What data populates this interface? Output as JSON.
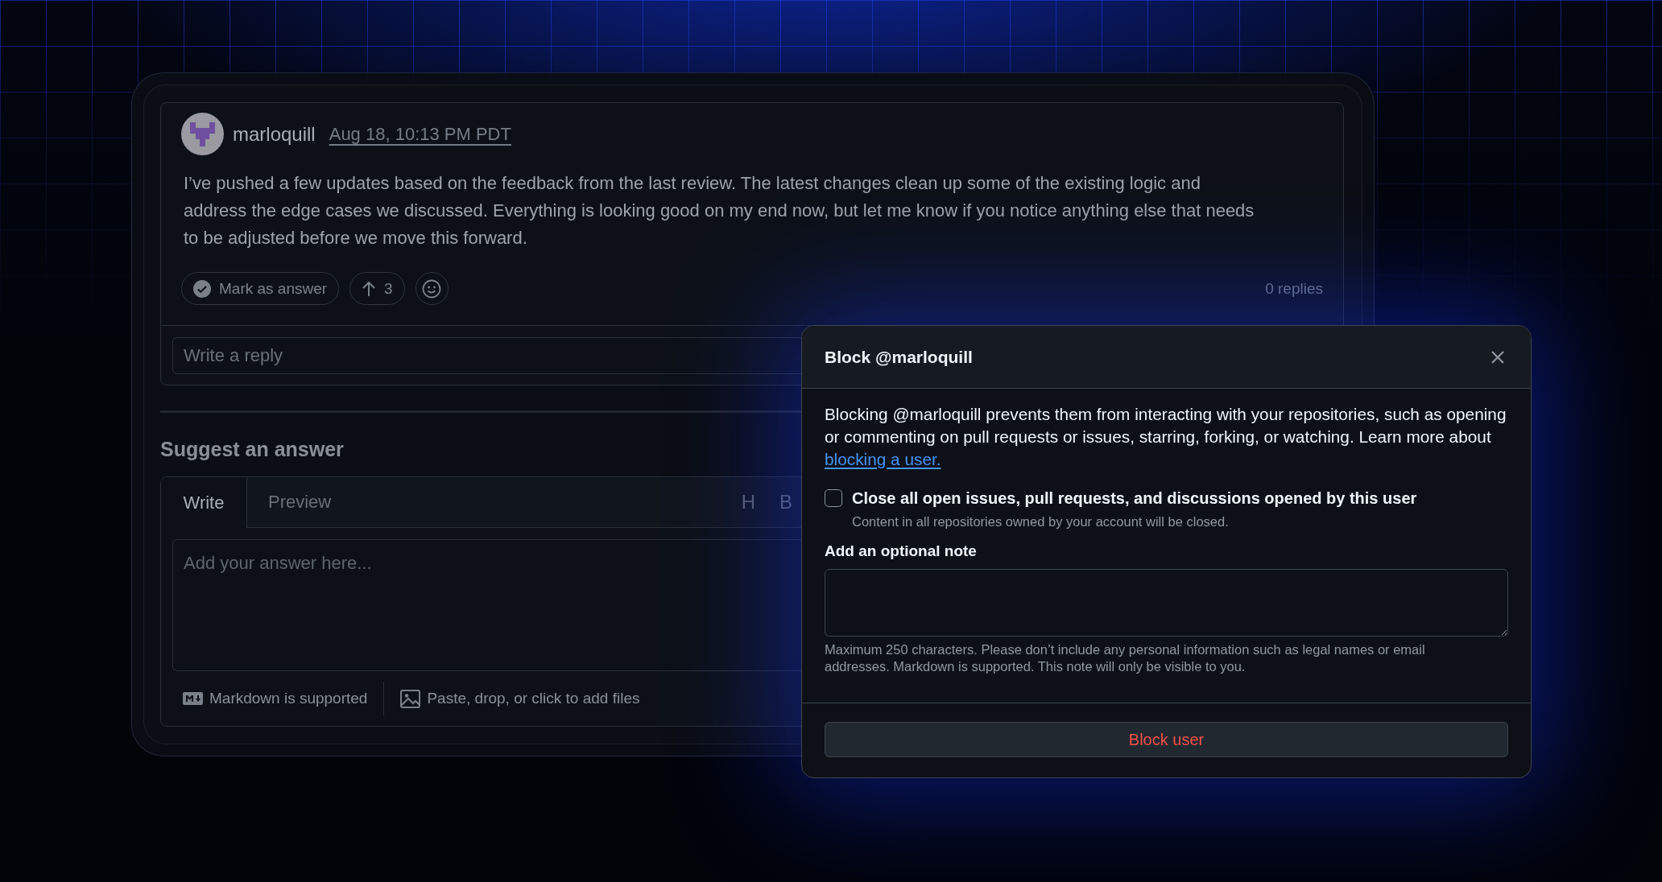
{
  "comment": {
    "author": "marloquill",
    "timestamp": "Aug 18, 10:13 PM PDT",
    "body": "I’ve pushed a few updates based on the feedback from the last review. The latest changes clean up some of the existing logic and address the edge cases we discussed. Everything is looking good on my end now, but let me know if you notice anything else that needs to be adjusted before we move this forward.",
    "actions": [
      {
        "kind": "mark-answer",
        "label": "Mark as answer"
      },
      {
        "kind": "upvote",
        "label": "3"
      },
      {
        "kind": "reaction"
      }
    ],
    "replies": "0 replies",
    "reply_field": {
      "placeholder": "Write a reply"
    }
  },
  "answer_editor": {
    "heading": "Suggest an answer",
    "tabs": [
      {
        "label": "Write",
        "selected": true
      },
      {
        "label": "Preview",
        "selected": false
      }
    ],
    "toolbar": [
      "H",
      "B"
    ],
    "textarea": {
      "placeholder": "Add your answer here..."
    },
    "footer": [
      {
        "kind": "markdown",
        "label": "Markdown is supported"
      },
      {
        "kind": "attach",
        "label": "Paste, drop, or click to add files"
      }
    ]
  },
  "dialog": {
    "title": "Block @marloquill",
    "description": "Blocking @marloquill prevents them from interacting with your repositories, such as opening or commenting on pull requests or issues, starring, forking, or watching. Learn more about ",
    "link": "blocking a user.",
    "option": {
      "label": "Close all open issues, pull requests, and discussions opened by this user",
      "hint": "Content in all repositories owned by your account will be closed.",
      "checked": false
    },
    "note": {
      "label": "Add an optional note",
      "hint": "Maximum 250 characters. Please don’t include any personal information such as legal names or email addresses. Markdown is supported. This note will only be visible to you."
    },
    "button": "Block user"
  }
}
